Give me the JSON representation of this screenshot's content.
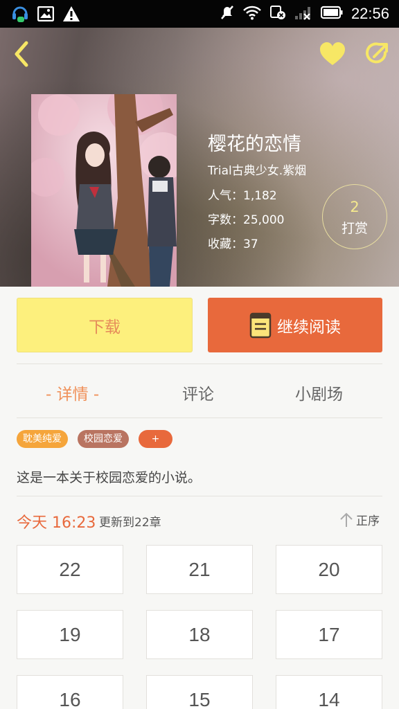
{
  "status_bar": {
    "time": "22:56",
    "icons": [
      "headset-icon",
      "image-icon",
      "warning-icon",
      "mute-icon",
      "wifi-icon",
      "sim-icon",
      "signal-icon",
      "battery-icon"
    ]
  },
  "book": {
    "title": "樱花的恋情",
    "author": "Trial古典少女.紫烟",
    "popularity": "人气：1,182",
    "word_count": "字数：25,000",
    "favorites": "收藏：37",
    "reward": {
      "count": "2",
      "label": "打赏"
    }
  },
  "actions": {
    "download_label": "下载",
    "continue_label": "继续阅读"
  },
  "tabs": [
    {
      "label": "- 详情 -",
      "active": true
    },
    {
      "label": "评论",
      "active": false
    },
    {
      "label": "小剧场",
      "active": false
    }
  ],
  "tags": [
    "耽美纯爱",
    "校园恋爱",
    "+"
  ],
  "description": "这是一本关于校园恋爱的小说。",
  "update": {
    "time": "今天 16:23",
    "text": "更新到22章",
    "sort_label": "正序"
  },
  "chapters": [
    "22",
    "21",
    "20",
    "19",
    "18",
    "17",
    "16",
    "15",
    "14"
  ],
  "colors": {
    "accent": "#e8693c",
    "download": "#fdf07d",
    "active_tab": "#f0915a",
    "tag_orange": "#f5a53b",
    "tag_brown": "#b97461",
    "icon_yellow": "#f7e765"
  }
}
